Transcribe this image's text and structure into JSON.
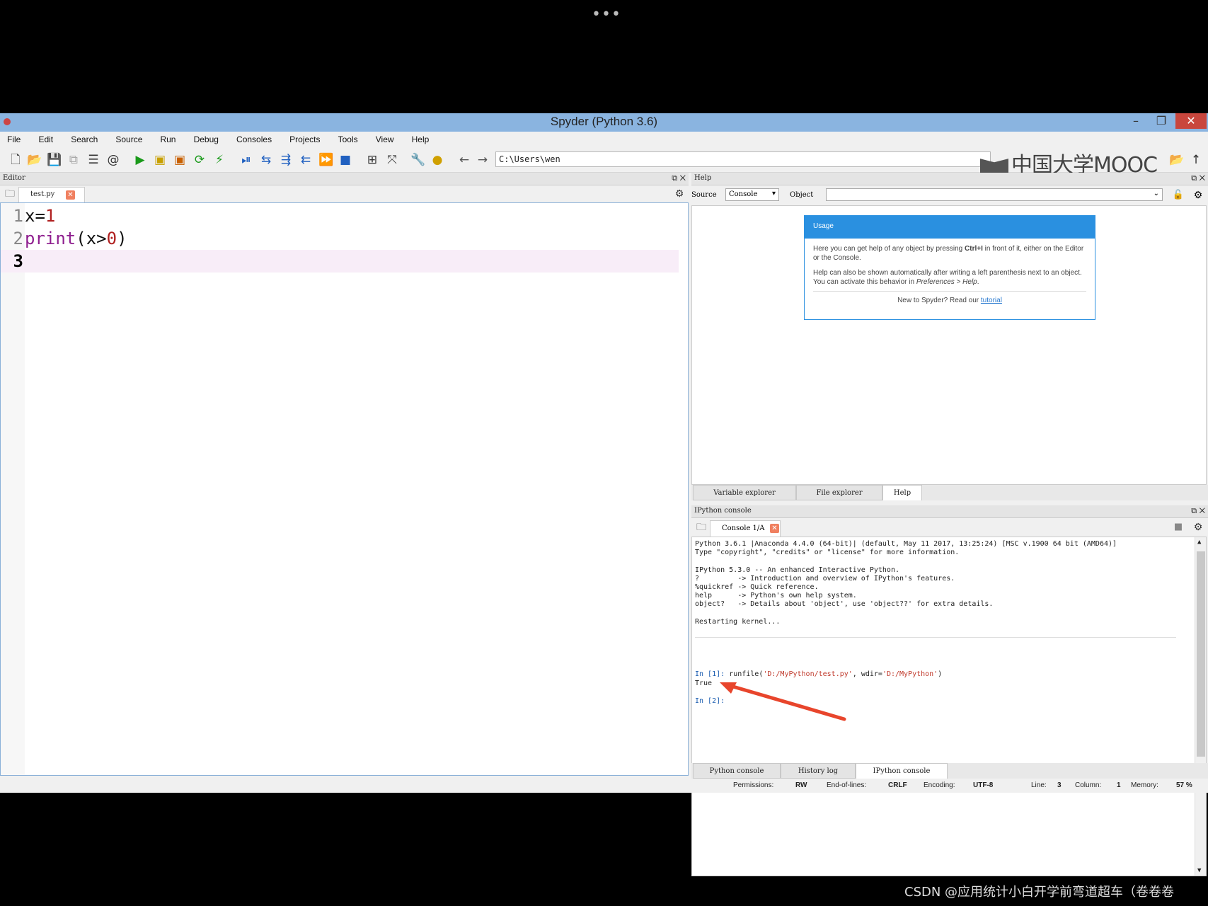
{
  "window": {
    "title": "Spyder (Python 3.6)"
  },
  "menu": [
    "File",
    "Edit",
    "Search",
    "Source",
    "Run",
    "Debug",
    "Consoles",
    "Projects",
    "Tools",
    "View",
    "Help"
  ],
  "toolbar": {
    "path": "C:\\Users\\wen"
  },
  "logo": {
    "text": "中国大学MOOC"
  },
  "editor": {
    "pane_title": "Editor",
    "tab_label": "test.py",
    "lines": [
      {
        "num": "1",
        "parts": [
          {
            "t": "x=",
            "c": "tx"
          },
          {
            "t": "1",
            "c": "num"
          }
        ]
      },
      {
        "num": "2",
        "parts": [
          {
            "t": "print",
            "c": "kw"
          },
          {
            "t": "(x>",
            "c": "tx"
          },
          {
            "t": "0",
            "c": "num"
          },
          {
            "t": ")",
            "c": "tx"
          }
        ]
      },
      {
        "num": "3",
        "parts": []
      }
    ],
    "current_line": 3
  },
  "help": {
    "pane_title": "Help",
    "source_label": "Source",
    "source_value": "Console",
    "object_label": "Object",
    "usage_title": "Usage",
    "usage_p1_a": "Here you can get help of any object by pressing ",
    "usage_p1_b": "Ctrl+I",
    "usage_p1_c": " in front of it, either on the Editor or the Console.",
    "usage_p2_a": "Help can also be shown automatically after writing a left parenthesis next to an object. You can activate this behavior in ",
    "usage_p2_b": "Preferences > Help",
    "usage_p2_c": ".",
    "new_text": "New to Spyder? Read our ",
    "tutorial_link": "tutorial",
    "tabs": [
      "Variable explorer",
      "File explorer",
      "Help"
    ],
    "active_tab": "Help"
  },
  "console": {
    "pane_title": "IPython console",
    "tab_label": "Console 1/A",
    "lines": [
      "Python 3.6.1 |Anaconda 4.4.0 (64-bit)| (default, May 11 2017, 13:25:24) [MSC v.1900 64 bit (AMD64)]",
      "Type \"copyright\", \"credits\" or \"license\" for more information.",
      "",
      "IPython 5.3.0 -- An enhanced Interactive Python.",
      "?         -> Introduction and overview of IPython's features.",
      "%quickref -> Quick reference.",
      "help      -> Python's own help system.",
      "object?   -> Details about 'object', use 'object??' for extra details.",
      "",
      "Restarting kernel..."
    ],
    "in1_prompt": "In [1]: ",
    "in1_code_a": "runfile(",
    "in1_str1": "'D:/MyPython/test.py'",
    "in1_code_b": ", wdir=",
    "in1_str2": "'D:/MyPython'",
    "in1_code_c": ")",
    "output": "True",
    "in2_prompt": "In [2]:",
    "tabs": [
      "Python console",
      "History log",
      "IPython console"
    ],
    "active_tab": "IPython console"
  },
  "status": {
    "permissions_label": "Permissions:",
    "permissions": "RW",
    "eol_label": "End-of-lines:",
    "eol": "CRLF",
    "encoding_label": "Encoding:",
    "encoding": "UTF-8",
    "line_label": "Line:",
    "line": "3",
    "column_label": "Column:",
    "column": "1",
    "memory_label": "Memory:",
    "memory": "57 %"
  },
  "watermark": "CSDN @应用统计小白开学前弯道超车（卷卷卷",
  "colors": {
    "titlebar": "#8ab4e0",
    "accent": "#2a90e0",
    "close": "#c9463d",
    "arrow": "#e8452c"
  }
}
